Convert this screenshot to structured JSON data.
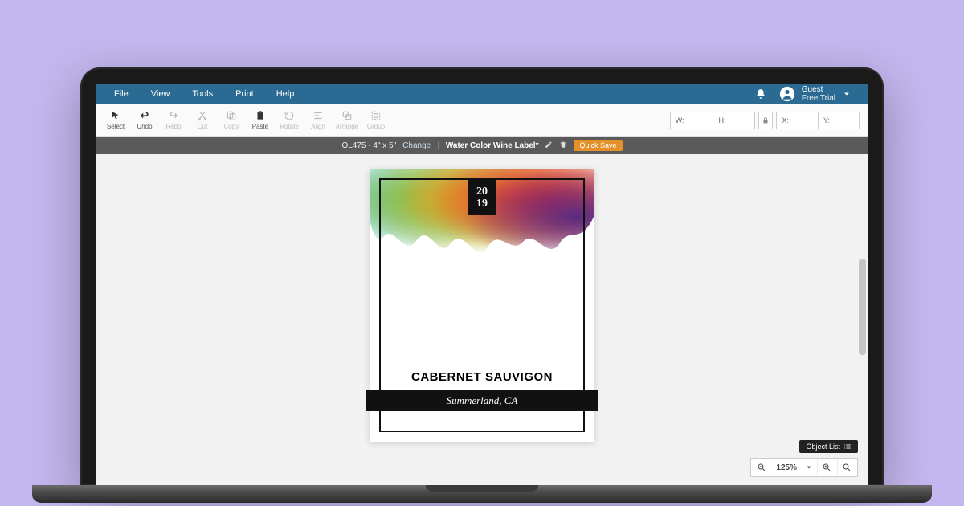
{
  "menubar": {
    "items": [
      "File",
      "View",
      "Tools",
      "Print",
      "Help"
    ]
  },
  "user": {
    "name": "Guest",
    "plan": "Free Trial"
  },
  "toolbar": {
    "select": "Select",
    "undo": "Undo",
    "redo": "Redo",
    "cut": "Cut",
    "copy": "Copy",
    "paste": "Paste",
    "rotate": "Rotate",
    "align": "Align",
    "arrange": "Arrange",
    "group": "Group",
    "dims": {
      "w_label": "W:",
      "h_label": "H:",
      "x_label": "X:",
      "y_label": "Y:"
    }
  },
  "docbar": {
    "sku": "OL475 - 4\" x 5\"",
    "change": "Change",
    "title": "Water Color Wine Label*",
    "quick_save": "Quick Save"
  },
  "label": {
    "year_top": "20",
    "year_bottom": "19",
    "wine": "CABERNET SAUVIGON",
    "origin": "Summerland, CA"
  },
  "footer": {
    "object_list": "Object List",
    "zoom": "125%"
  }
}
